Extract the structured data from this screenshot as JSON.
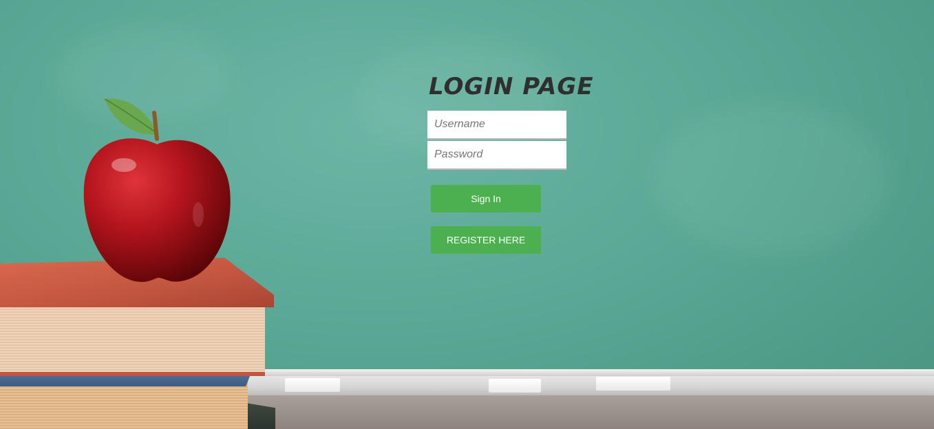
{
  "login": {
    "title": "LOGIN PAGE",
    "username_placeholder": "Username",
    "password_placeholder": "Password",
    "signin_label": "Sign In",
    "register_label": "REGISTER HERE"
  },
  "colors": {
    "button": "#4caf50",
    "chalkboard": "#5aa895",
    "title": "#2f2f2f"
  },
  "background": {
    "icons": [
      "apple-illustration",
      "book-stack-illustration",
      "chalk-tray"
    ]
  }
}
